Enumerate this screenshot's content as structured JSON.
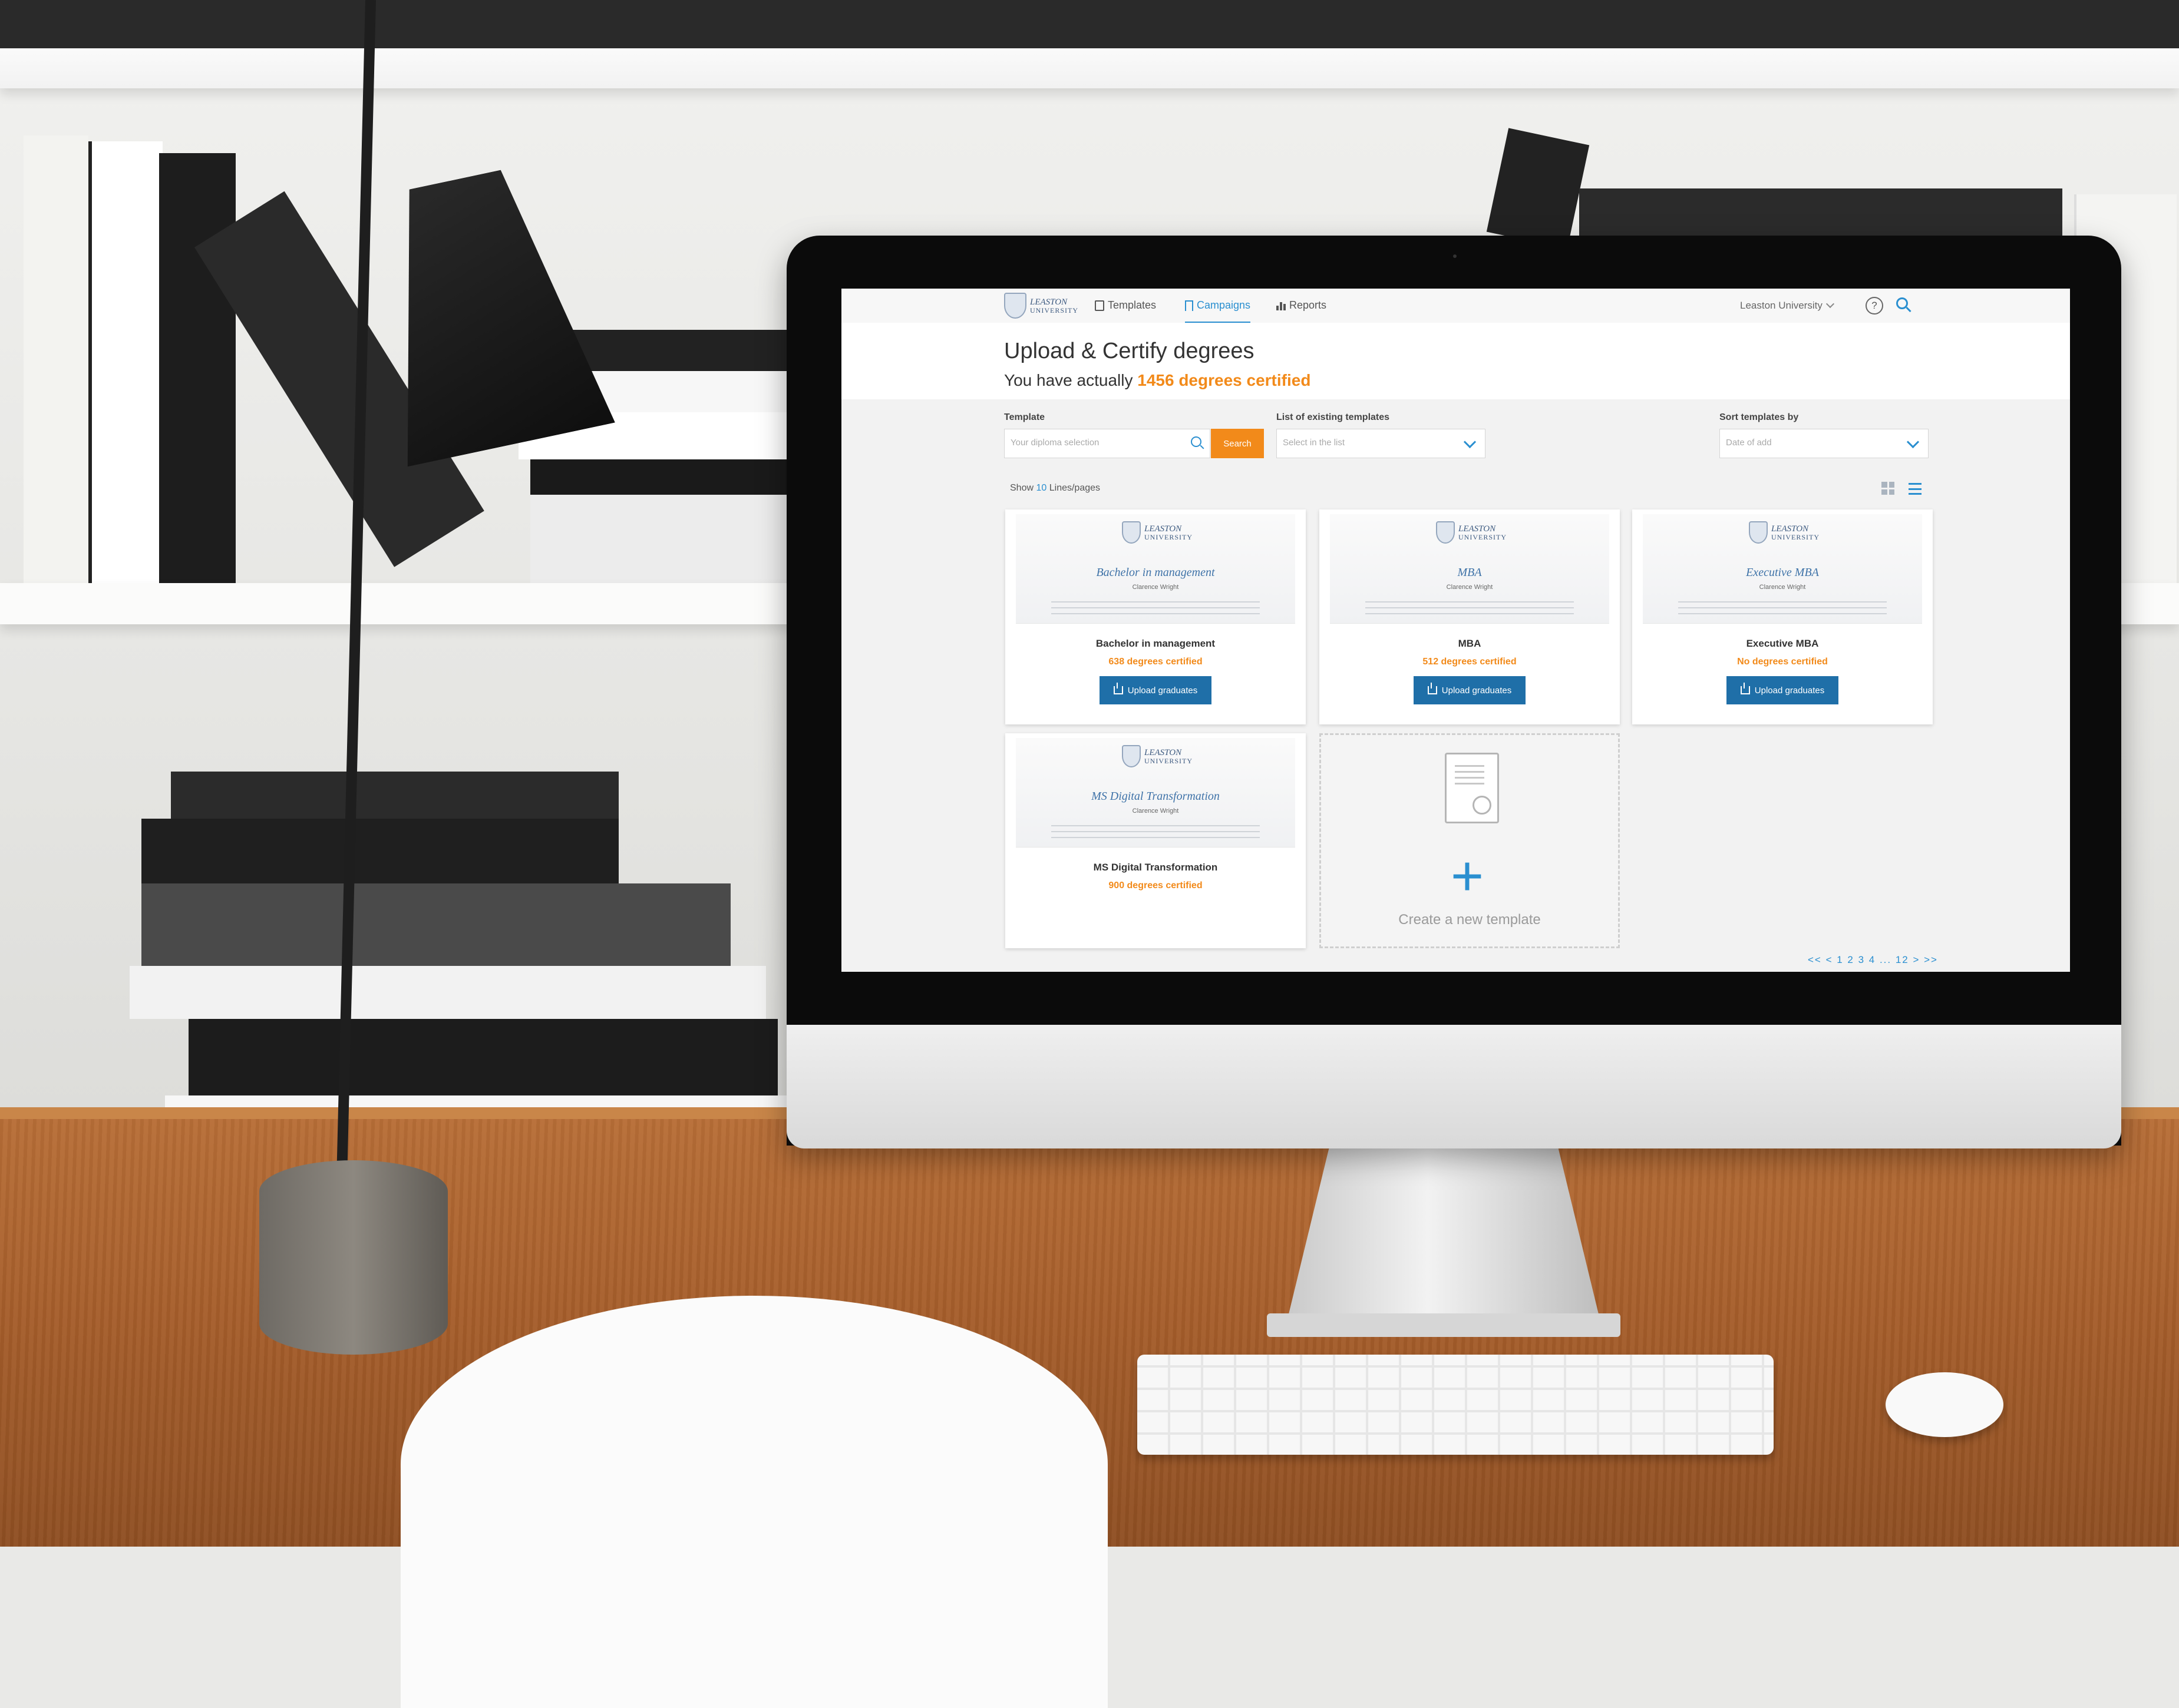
{
  "colors": {
    "accent": "#2a8fd0",
    "highlight": "#f28a1a",
    "button_dark": "#1f6fa8"
  },
  "nav": {
    "logo_line1": "LEASTON",
    "logo_line2": "UNIVERSITY",
    "items": [
      {
        "label": "Templates",
        "icon": "document-icon",
        "active": false
      },
      {
        "label": "Campaigns",
        "icon": "bookmark-icon",
        "active": true
      },
      {
        "label": "Reports",
        "icon": "bar-chart-icon",
        "active": false
      }
    ],
    "organization": "Leaston University",
    "help_symbol": "?"
  },
  "header": {
    "title": "Upload & Certify degrees",
    "subtitle_prefix": "You have actually",
    "count": "1456",
    "subtitle_suffix": "degrees certified"
  },
  "filters": {
    "template_label": "Template",
    "template_placeholder": "Your diploma selection",
    "search_button": "Search",
    "list_label": "List of existing templates",
    "list_placeholder": "Select in the list",
    "sort_label": "Sort templates by",
    "sort_value": "Date of add"
  },
  "pagination_top": {
    "show": "Show",
    "count": "10",
    "suffix": "Lines/pages"
  },
  "cards": [
    {
      "thumb_title": "Bachelor in management",
      "person": "Clarence Wright",
      "name": "Bachelor in management",
      "certified": "638 degrees certified",
      "button": "Upload graduates"
    },
    {
      "thumb_title": "MBA",
      "person": "Clarence Wright",
      "name": "MBA",
      "certified": "512 degrees certified",
      "button": "Upload graduates"
    },
    {
      "thumb_title": "Executive MBA",
      "person": "Clarence Wright",
      "name": "Executive MBA",
      "certified": "No degrees certified",
      "button": "Upload graduates"
    },
    {
      "thumb_title": "MS Digital Transformation",
      "person": "Clarence Wright",
      "name": "MS Digital Transformation",
      "certified": "900 degrees certified"
    }
  ],
  "new_template": {
    "label": "Create a new template",
    "plus": "+"
  },
  "pager": "<< < 1 2 3 4 ... 12 > >>"
}
